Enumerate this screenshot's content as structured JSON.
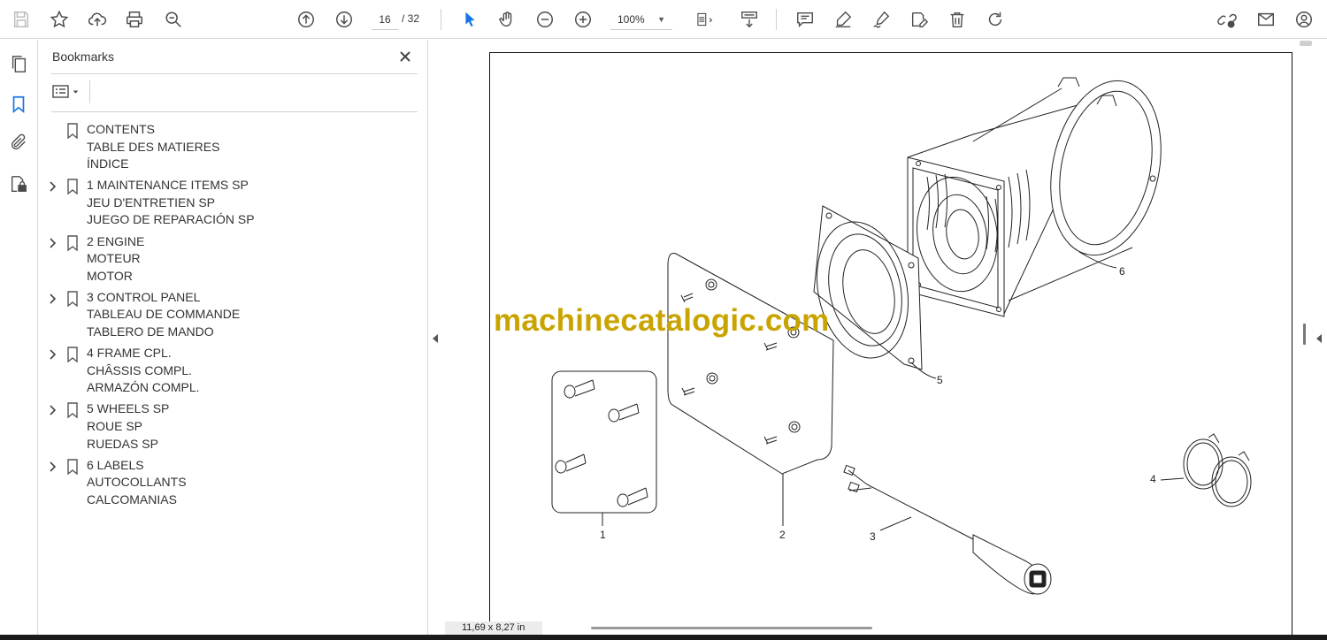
{
  "toolbar": {
    "page_current": "16",
    "page_total": "/ 32",
    "zoom": "100%"
  },
  "bookmarks": {
    "title": "Bookmarks",
    "items": [
      {
        "lines": [
          "CONTENTS",
          "TABLE DES MATIERES",
          "ÍNDICE"
        ],
        "expandable": false
      },
      {
        "lines": [
          "1 MAINTENANCE ITEMS SP",
          "JEU D'ENTRETIEN SP",
          "JUEGO DE REPARACIÓN SP"
        ],
        "expandable": true
      },
      {
        "lines": [
          "2 ENGINE",
          "MOTEUR",
          "MOTOR"
        ],
        "expandable": true
      },
      {
        "lines": [
          "3 CONTROL PANEL",
          "TABLEAU DE COMMANDE",
          "TABLERO DE MANDO"
        ],
        "expandable": true
      },
      {
        "lines": [
          "4 FRAME CPL.",
          "CHÂSSIS COMPL.",
          "ARMAZÓN COMPL."
        ],
        "expandable": true
      },
      {
        "lines": [
          "5 WHEELS SP",
          "ROUE SP",
          "RUEDAS SP"
        ],
        "expandable": true
      },
      {
        "lines": [
          "6 LABELS",
          "AUTOCOLLANTS",
          "CALCOMANIAS"
        ],
        "expandable": true
      }
    ]
  },
  "document": {
    "watermark": "machinecatalogic.com",
    "callouts": [
      "1",
      "2",
      "3",
      "4",
      "5",
      "6"
    ],
    "page_size": "11,69 x 8,27 in"
  },
  "colors": {
    "accent": "#1473e6",
    "watermark": "#c9a400",
    "icon": "#4b4b4b"
  }
}
